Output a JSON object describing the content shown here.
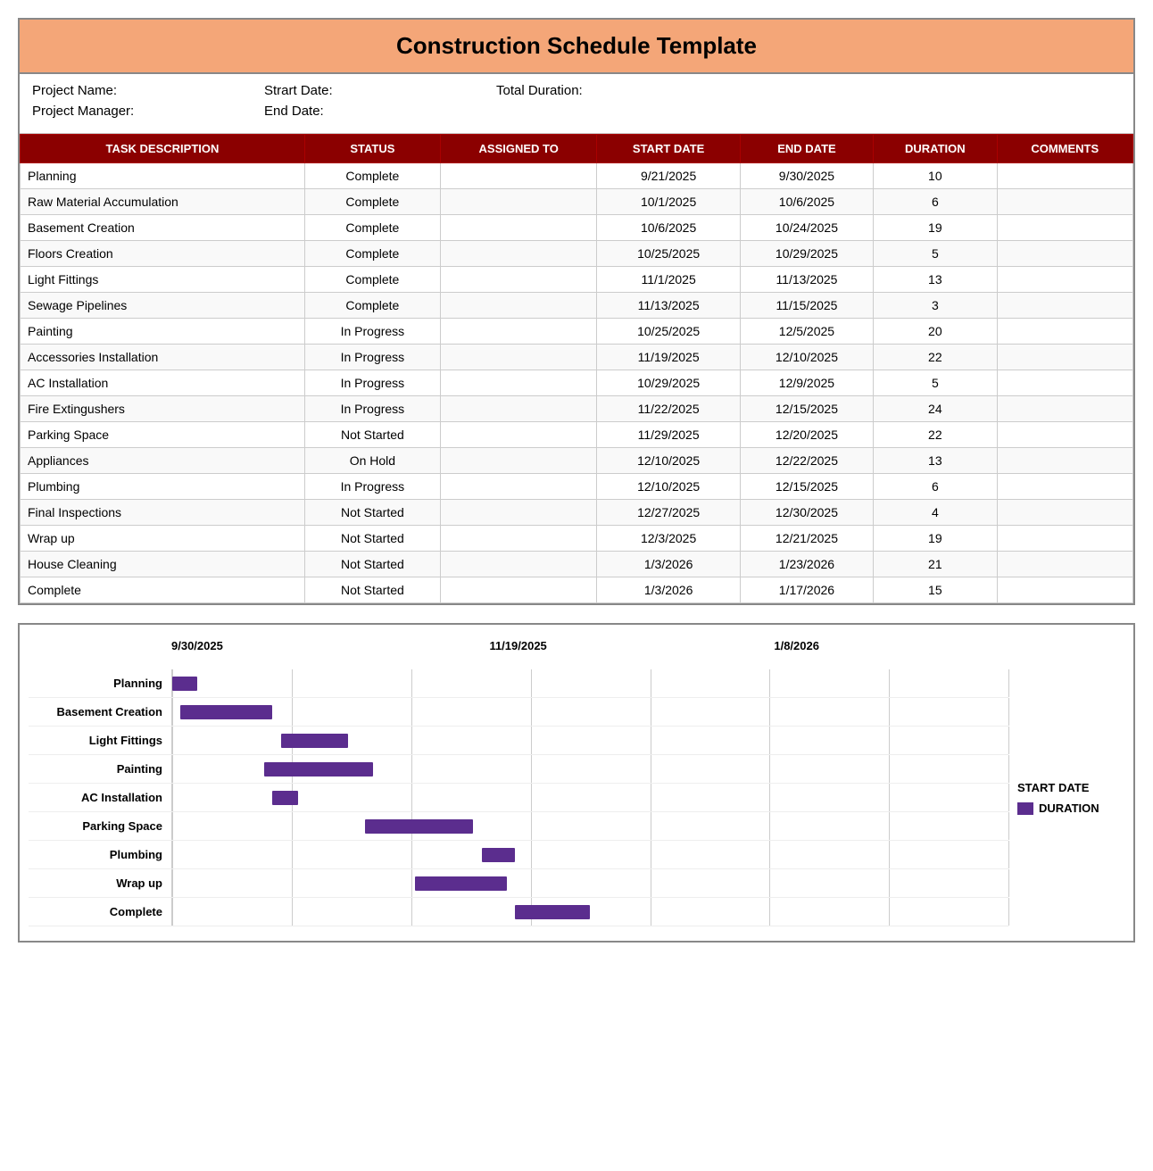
{
  "title": "Construction Schedule Template",
  "project_fields": {
    "name_label": "Project Name:",
    "start_label": "Strart Date:",
    "duration_label": "Total Duration:",
    "manager_label": "Project Manager:",
    "end_label": "End Date:"
  },
  "table": {
    "headers": [
      "TASK DESCRIPTION",
      "STATUS",
      "ASSIGNED TO",
      "START DATE",
      "END DATE",
      "DURATION",
      "COMMENTS"
    ],
    "rows": [
      {
        "task": "Planning",
        "status": "Complete",
        "assigned": "",
        "start": "9/21/2025",
        "end": "9/30/2025",
        "duration": "10",
        "comments": ""
      },
      {
        "task": "Raw Material Accumulation",
        "status": "Complete",
        "assigned": "",
        "start": "10/1/2025",
        "end": "10/6/2025",
        "duration": "6",
        "comments": ""
      },
      {
        "task": "Basement Creation",
        "status": "Complete",
        "assigned": "",
        "start": "10/6/2025",
        "end": "10/24/2025",
        "duration": "19",
        "comments": ""
      },
      {
        "task": "Floors Creation",
        "status": "Complete",
        "assigned": "",
        "start": "10/25/2025",
        "end": "10/29/2025",
        "duration": "5",
        "comments": ""
      },
      {
        "task": "Light Fittings",
        "status": "Complete",
        "assigned": "",
        "start": "11/1/2025",
        "end": "11/13/2025",
        "duration": "13",
        "comments": ""
      },
      {
        "task": "Sewage Pipelines",
        "status": "Complete",
        "assigned": "",
        "start": "11/13/2025",
        "end": "11/15/2025",
        "duration": "3",
        "comments": ""
      },
      {
        "task": "Painting",
        "status": "In Progress",
        "assigned": "",
        "start": "10/25/2025",
        "end": "12/5/2025",
        "duration": "20",
        "comments": ""
      },
      {
        "task": "Accessories Installation",
        "status": "In Progress",
        "assigned": "",
        "start": "11/19/2025",
        "end": "12/10/2025",
        "duration": "22",
        "comments": ""
      },
      {
        "task": "AC Installation",
        "status": "In Progress",
        "assigned": "",
        "start": "10/29/2025",
        "end": "12/9/2025",
        "duration": "5",
        "comments": ""
      },
      {
        "task": "Fire Extingushers",
        "status": "In Progress",
        "assigned": "",
        "start": "11/22/2025",
        "end": "12/15/2025",
        "duration": "24",
        "comments": ""
      },
      {
        "task": "Parking Space",
        "status": "Not Started",
        "assigned": "",
        "start": "11/29/2025",
        "end": "12/20/2025",
        "duration": "22",
        "comments": ""
      },
      {
        "task": "Appliances",
        "status": "On Hold",
        "assigned": "",
        "start": "12/10/2025",
        "end": "12/22/2025",
        "duration": "13",
        "comments": ""
      },
      {
        "task": "Plumbing",
        "status": "In Progress",
        "assigned": "",
        "start": "12/10/2025",
        "end": "12/15/2025",
        "duration": "6",
        "comments": ""
      },
      {
        "task": "Final Inspections",
        "status": "Not Started",
        "assigned": "",
        "start": "12/27/2025",
        "end": "12/30/2025",
        "duration": "4",
        "comments": ""
      },
      {
        "task": "Wrap up",
        "status": "Not Started",
        "assigned": "",
        "start": "12/3/2025",
        "end": "12/21/2025",
        "duration": "19",
        "comments": ""
      },
      {
        "task": "House Cleaning",
        "status": "Not Started",
        "assigned": "",
        "start": "1/3/2026",
        "end": "1/23/2026",
        "duration": "21",
        "comments": ""
      },
      {
        "task": "Complete",
        "status": "Not Started",
        "assigned": "",
        "start": "1/3/2026",
        "end": "1/17/2026",
        "duration": "15",
        "comments": ""
      }
    ]
  },
  "gantt": {
    "date_labels": [
      "9/30/2025",
      "11/19/2025",
      "1/8/2026"
    ],
    "legend": {
      "start_label": "START DATE",
      "duration_label": "DURATION"
    },
    "rows": [
      {
        "label": "Planning",
        "start_pct": 0,
        "width_pct": 3
      },
      {
        "label": "Basement Creation",
        "start_pct": 1,
        "width_pct": 11
      },
      {
        "label": "Light Fittings",
        "start_pct": 13,
        "width_pct": 8
      },
      {
        "label": "Painting",
        "start_pct": 11,
        "width_pct": 13
      },
      {
        "label": "AC Installation",
        "start_pct": 12,
        "width_pct": 3
      },
      {
        "label": "Parking Space",
        "start_pct": 23,
        "width_pct": 13
      },
      {
        "label": "Plumbing",
        "start_pct": 37,
        "width_pct": 4
      },
      {
        "label": "Wrap up",
        "start_pct": 29,
        "width_pct": 11
      },
      {
        "label": "Complete",
        "start_pct": 41,
        "width_pct": 9
      }
    ]
  }
}
